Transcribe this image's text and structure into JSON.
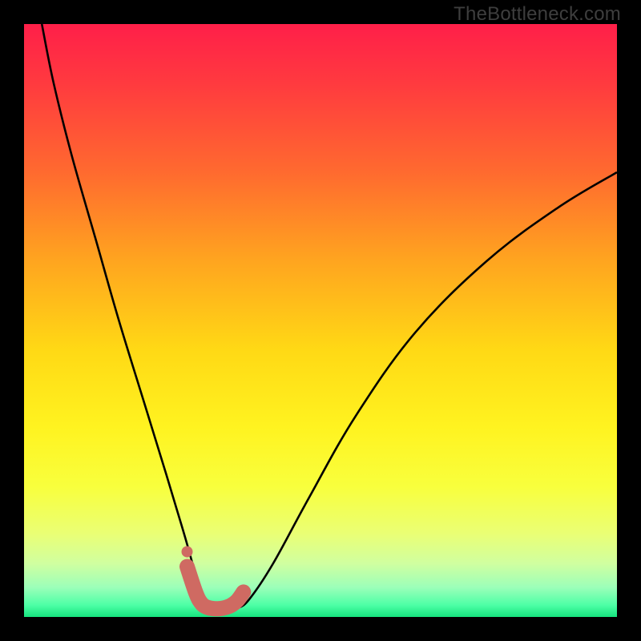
{
  "watermark": "TheBottleneck.com",
  "colors": {
    "frame": "#000000",
    "curve": "#000000",
    "marker": "#cf6a62",
    "gradient_stops": [
      {
        "offset": 0.0,
        "color": "#ff1f49"
      },
      {
        "offset": 0.1,
        "color": "#ff3a3f"
      },
      {
        "offset": 0.25,
        "color": "#ff6a2f"
      },
      {
        "offset": 0.4,
        "color": "#ffa51f"
      },
      {
        "offset": 0.55,
        "color": "#ffd915"
      },
      {
        "offset": 0.68,
        "color": "#fff320"
      },
      {
        "offset": 0.78,
        "color": "#f8ff3d"
      },
      {
        "offset": 0.86,
        "color": "#eaff75"
      },
      {
        "offset": 0.91,
        "color": "#d0ffa0"
      },
      {
        "offset": 0.95,
        "color": "#9cffb9"
      },
      {
        "offset": 0.98,
        "color": "#4dffa6"
      },
      {
        "offset": 1.0,
        "color": "#16e47e"
      }
    ]
  },
  "chart_data": {
    "type": "line",
    "title": "",
    "xlabel": "",
    "ylabel": "",
    "xlim": [
      0,
      100
    ],
    "ylim": [
      0,
      100
    ],
    "series": [
      {
        "name": "bottleneck-curve",
        "x": [
          3,
          5,
          8,
          12,
          16,
          20,
          24,
          27,
          29,
          30.5,
          32,
          34,
          36,
          38,
          42,
          48,
          56,
          66,
          78,
          90,
          100
        ],
        "values": [
          100,
          90,
          78,
          64,
          50,
          37,
          24,
          14,
          7,
          3,
          1.5,
          1.3,
          1.5,
          3,
          9,
          20,
          34,
          48,
          60,
          69,
          75
        ]
      }
    ],
    "markers": {
      "name": "highlight-band",
      "x": [
        27.5,
        29,
        30,
        31,
        32,
        33,
        34,
        35,
        36,
        37
      ],
      "values": [
        8.5,
        4,
        2.2,
        1.6,
        1.4,
        1.4,
        1.6,
        2.0,
        2.8,
        4.2
      ],
      "extra_dot": {
        "x": 27.5,
        "y": 11
      }
    }
  }
}
